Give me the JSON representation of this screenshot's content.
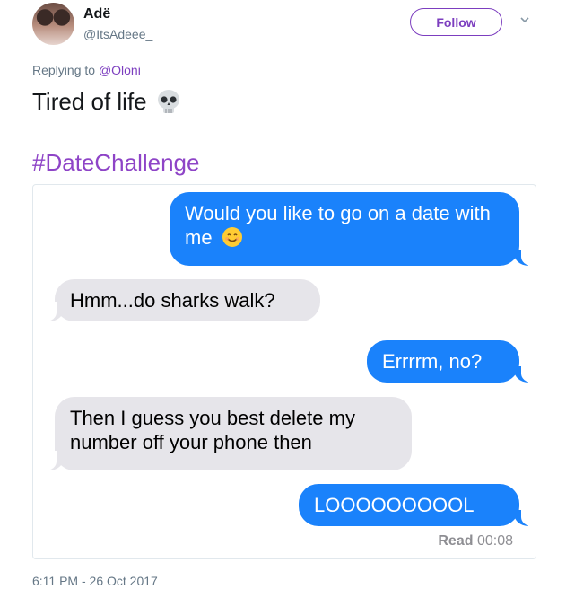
{
  "user": {
    "display_name": "Adë",
    "handle": "@ItsAdeee_"
  },
  "follow_button": {
    "label": "Follow"
  },
  "reply": {
    "prefix": "Replying to ",
    "mention": "@Oloni"
  },
  "tweet": {
    "text": "Tired of life",
    "emoji": "skull-icon"
  },
  "hashtag": "#DateChallenge",
  "conversation": {
    "messages": [
      {
        "from": "me",
        "text": "Would you like to go on a date with me",
        "emoji": "smiley-icon"
      },
      {
        "from": "them",
        "text": "Hmm...do sharks walk?"
      },
      {
        "from": "me",
        "text": "Errrrm, no?"
      },
      {
        "from": "them",
        "text": "Then I guess you best delete my number off your phone then"
      },
      {
        "from": "me",
        "text": "LOOOOOOOOOL"
      }
    ],
    "read_label": "Read",
    "read_time": "00:08"
  },
  "timestamp": "6:11 PM - 26 Oct 2017",
  "colors": {
    "accent": "#7c3ebf",
    "sent_bubble": "#1a82fb",
    "received_bubble": "#e6e5ea"
  }
}
